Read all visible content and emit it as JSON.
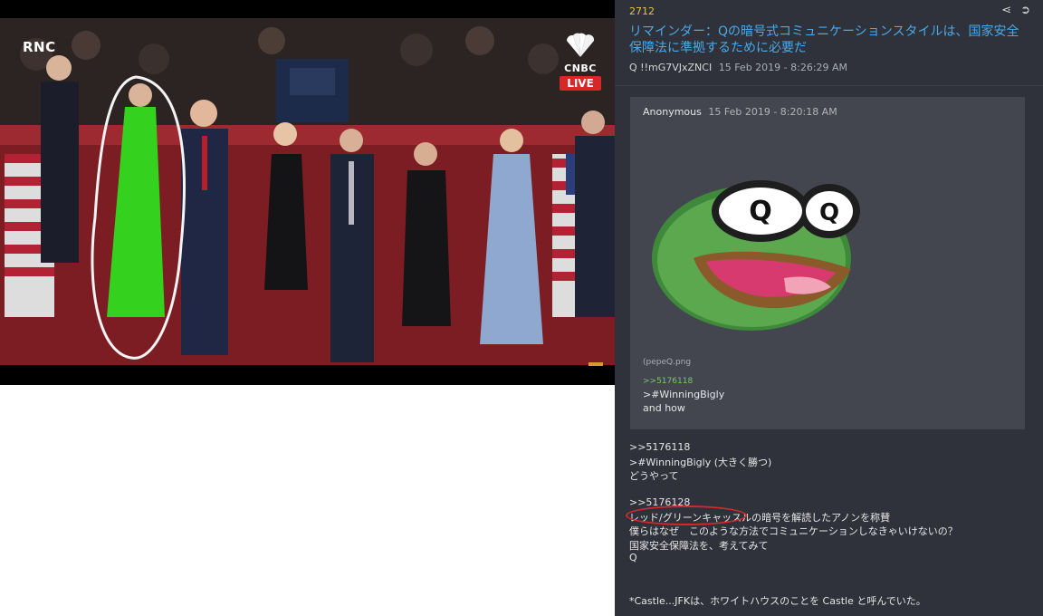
{
  "video": {
    "network_left": "RNC",
    "network_right": "CNBC",
    "live_badge": "LIVE"
  },
  "post": {
    "number": "2712",
    "title": "リマインダー：Qの暗号式コミュニケーションスタイルは、国家安全保障法に準拠するために必要だ",
    "author": "Q",
    "tripcode": "!!mG7VJxZNCI",
    "date": "15 Feb 2019 - 8:26:29 AM",
    "actions": {
      "share_icon": "share-icon",
      "goto_icon": "arrow-right-circle-icon"
    }
  },
  "quoted": {
    "author": "Anonymous",
    "date": "15 Feb 2019 - 8:20:18 AM",
    "filename": "(pepeQ.png",
    "image_letters": [
      "Q",
      "Q"
    ],
    "link": ">>5176118",
    "line1": ">#WinningBigly",
    "line2": "and how"
  },
  "body": {
    "lines": [
      ">>5176118",
      ">#WinningBigly (大きく勝つ)",
      "どうやって",
      "",
      ">>5176128",
      "レッド/グリーンキャッスルの暗号を解読したアノンを称賛",
      "僕らはなぜ　このような方法でコミュニケーションしなきゃいけないの？",
      "国家安全保障法を、考えてみて",
      "Q",
      "",
      "",
      "*Castle...JFKは、ホワイトハウスのことを Castle と呼んでいた。"
    ]
  }
}
